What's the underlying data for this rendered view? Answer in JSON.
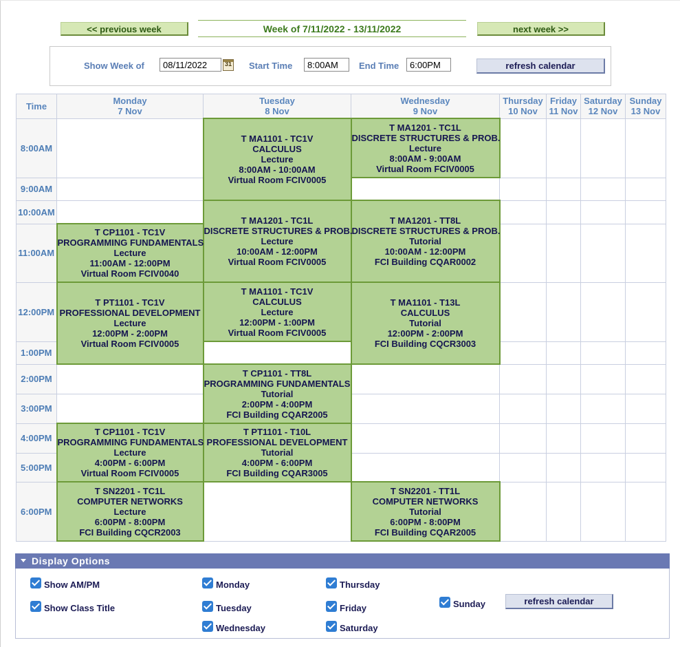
{
  "nav": {
    "prev_label": "<< previous week",
    "next_label": "next week >>",
    "week_title": "Week of 7/11/2022 - 13/11/2022"
  },
  "filter": {
    "show_week_label": "Show Week of",
    "show_week_value": "08/11/2022",
    "calendar_icon_text": "31",
    "start_time_label": "Start Time",
    "start_time_value": "8:00AM",
    "end_time_label": "End Time",
    "end_time_value": "6:00PM",
    "refresh_label": "refresh calendar"
  },
  "grid": {
    "time_header": "Time",
    "days": [
      {
        "day": "Monday",
        "date": "7 Nov"
      },
      {
        "day": "Tuesday",
        "date": "8 Nov"
      },
      {
        "day": "Wednesday",
        "date": "9 Nov"
      },
      {
        "day": "Thursday",
        "date": "10 Nov"
      },
      {
        "day": "Friday",
        "date": "11 Nov"
      },
      {
        "day": "Saturday",
        "date": "12 Nov"
      },
      {
        "day": "Sunday",
        "date": "13 Nov"
      }
    ],
    "times": [
      "8:00AM",
      "9:00AM",
      "10:00AM",
      "11:00AM",
      "12:00PM",
      "1:00PM",
      "2:00PM",
      "3:00PM",
      "4:00PM",
      "5:00PM",
      "6:00PM"
    ],
    "classes": {
      "tue_ma1101_lec": {
        "code": "T MA1101 - TC1V",
        "title": "CALCULUS",
        "type": "Lecture",
        "time": "8:00AM - 10:00AM",
        "room": "Virtual Room FCIV0005"
      },
      "wed_ma1201_lec": {
        "code": "T MA1201 - TC1L",
        "title": "DISCRETE STRUCTURES & PROB.",
        "type": "Lecture",
        "time": "8:00AM - 9:00AM",
        "room": "Virtual Room FCIV0005"
      },
      "tue_ma1201_lec": {
        "code": "T MA1201 - TC1L",
        "title": "DISCRETE STRUCTURES & PROB.",
        "type": "Lecture",
        "time": "10:00AM - 12:00PM",
        "room": "Virtual Room FCIV0005"
      },
      "wed_ma1201_tut": {
        "code": "T MA1201 - TT8L",
        "title": "DISCRETE STRUCTURES & PROB.",
        "type": "Tutorial",
        "time": "10:00AM - 12:00PM",
        "room": "FCI Building CQAR0002"
      },
      "mon_cp1101_lec1": {
        "code": "T CP1101 - TC1V",
        "title": "PROGRAMMING FUNDAMENTALS",
        "type": "Lecture",
        "time": "11:00AM - 12:00PM",
        "room": "Virtual Room FCIV0040"
      },
      "mon_pt1101_lec": {
        "code": "T PT1101 - TC1V",
        "title": "PROFESSIONAL DEVELOPMENT",
        "type": "Lecture",
        "time": "12:00PM - 2:00PM",
        "room": "Virtual Room FCIV0005"
      },
      "tue_ma1101_lec2": {
        "code": "T MA1101 - TC1V",
        "title": "CALCULUS",
        "type": "Lecture",
        "time": "12:00PM - 1:00PM",
        "room": "Virtual Room FCIV0005"
      },
      "wed_ma1101_tut": {
        "code": "T MA1101 - T13L",
        "title": "CALCULUS",
        "type": "Tutorial",
        "time": "12:00PM - 2:00PM",
        "room": "FCI Building CQCR3003"
      },
      "tue_cp1101_tut": {
        "code": "T CP1101 - TT8L",
        "title": "PROGRAMMING FUNDAMENTALS",
        "type": "Tutorial",
        "time": "2:00PM - 4:00PM",
        "room": "FCI Building CQAR2005"
      },
      "mon_cp1101_lec2": {
        "code": "T CP1101 - TC1V",
        "title": "PROGRAMMING FUNDAMENTALS",
        "type": "Lecture",
        "time": "4:00PM - 6:00PM",
        "room": "Virtual Room FCIV0005"
      },
      "tue_pt1101_tut": {
        "code": "T PT1101 - T10L",
        "title": "PROFESSIONAL DEVELOPMENT",
        "type": "Tutorial",
        "time": "4:00PM - 6:00PM",
        "room": "FCI Building CQAR3005"
      },
      "mon_sn2201_lec": {
        "code": "T SN2201 - TC1L",
        "title": "COMPUTER NETWORKS",
        "type": "Lecture",
        "time": "6:00PM - 8:00PM",
        "room": "FCI Building CQCR2003"
      },
      "wed_sn2201_tut": {
        "code": "T SN2201 - TT1L",
        "title": "COMPUTER NETWORKS",
        "type": "Tutorial",
        "time": "6:00PM - 8:00PM",
        "room": "FCI Building CQAR2005"
      }
    }
  },
  "display_options": {
    "header": "Display Options",
    "show_ampm": "Show AM/PM",
    "show_class_title": "Show Class Title",
    "monday": "Monday",
    "tuesday": "Tuesday",
    "wednesday": "Wednesday",
    "thursday": "Thursday",
    "friday": "Friday",
    "saturday": "Saturday",
    "sunday": "Sunday",
    "refresh_label": "refresh calendar"
  },
  "colors": {
    "class_fill": "#b3d294",
    "class_border": "#6c9a38",
    "header_bar": "#6a79b3",
    "checkbox": "#2f7dd3"
  }
}
